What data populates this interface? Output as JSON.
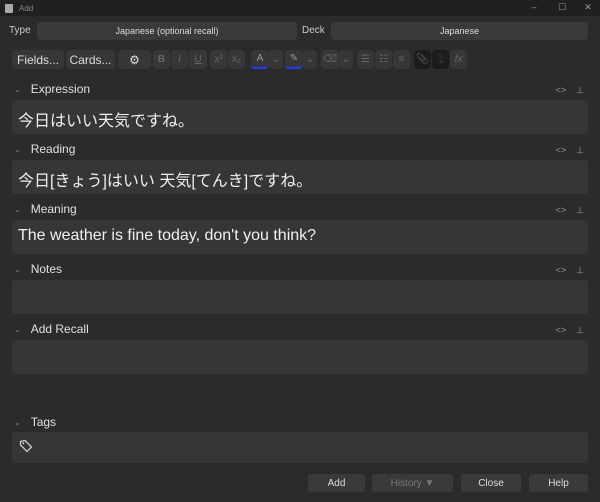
{
  "window": {
    "title": "Add",
    "minimize": "–",
    "maximize": "☐",
    "close": "✕"
  },
  "type": {
    "label": "Type",
    "value": "Japanese (optional recall)"
  },
  "deck": {
    "label": "Deck",
    "value": "Japanese"
  },
  "toolbar": {
    "fields": "Fields...",
    "cards": "Cards...",
    "gear": "⚙",
    "bold": "B",
    "italic": "I",
    "underline": "U",
    "superscript": "x²",
    "subscript": "x₂",
    "text_color": "A",
    "highlight": "✎",
    "dropdown": "⌄",
    "eraser": "⌫",
    "ul": "☰",
    "ol": "☷",
    "align": "≡",
    "attach": "📎",
    "record": "🎙",
    "math": "fx",
    "text_color_hex": "#1e3cff",
    "highlight_hex": "#1e3cff"
  },
  "fields": [
    {
      "name": "Expression",
      "value": "今日はいい天気ですね。"
    },
    {
      "name": "Reading",
      "value": "今日[きょう]はいい 天気[てんき]ですね。"
    },
    {
      "name": "Meaning",
      "value": "The weather is fine today, don't you think?"
    },
    {
      "name": "Notes",
      "value": ""
    },
    {
      "name": "Add Recall",
      "value": ""
    }
  ],
  "field_icons": {
    "html": "<>",
    "pin": "⊥",
    "chevron": "⌄"
  },
  "tags": {
    "label": "Tags",
    "icon": "tag-icon"
  },
  "buttons": {
    "add": "Add",
    "history": "History ▼",
    "close": "Close",
    "help": "Help"
  }
}
